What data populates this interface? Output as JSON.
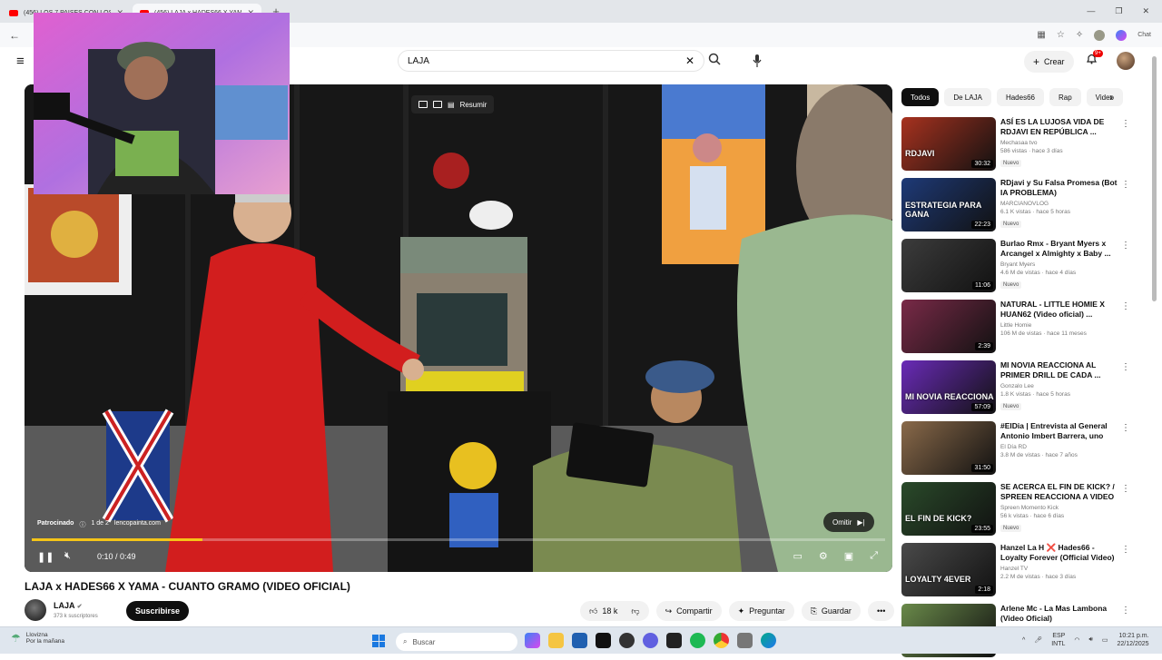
{
  "browser": {
    "tabs": [
      {
        "title": "(456) LOS 7 PAÍSES CON LOS HOM",
        "active": false
      },
      {
        "title": "(456) LAJA x HADES66 X YAMA",
        "active": true
      }
    ],
    "new_tab_icon": "plus-icon",
    "chat_label": "Chat"
  },
  "youtube": {
    "search_value": "LAJA",
    "create_label": "Crear",
    "notif_badge": "9+"
  },
  "player": {
    "overlay_summary": "Resumir",
    "sponsored": "Patrocinado",
    "ad_count": "1 de 2",
    "ad_domain": "lencopainta.com",
    "skip_label": "Omitir",
    "time": "0:10 / 0:49",
    "progress": 0.2,
    "progress_color": "#f5c518"
  },
  "video": {
    "title": "LAJA x HADES66 X YAMA - CUANTO GRAMO (VIDEO OFICIAL)",
    "channel": "LAJA",
    "subscribers": "373 k suscriptores",
    "subscribe_label": "Suscribirse",
    "likes": "18 k",
    "share_label": "Compartir",
    "ask_label": "Preguntar",
    "save_label": "Guardar"
  },
  "chips": [
    "Todos",
    "De LAJA",
    "Hades66",
    "Rap",
    "Video"
  ],
  "recommended": [
    {
      "title": "ASÍ ES LA LUJOSA VIDA DE RDJAVI EN REPÚBLICA ...",
      "channel": "Mechasaa tvo",
      "meta": "586 vistas · hace 3 días",
      "badge": "Nuevo",
      "duration": "30:32",
      "thumb": "#a8321f",
      "thumb_text": "RDJAVI"
    },
    {
      "title": "RDjavi y Su Falsa Promesa (Bot IA PROBLEMA)",
      "channel": "MARCIANOVLOG",
      "meta": "6.1 K vistas · hace 5 horas",
      "badge": "Nuevo",
      "duration": "22:23",
      "thumb": "#1e3a78",
      "thumb_text": "ESTRATEGIA PARA GANA"
    },
    {
      "title": "Burlao Rmx - Bryant Myers x Arcangel x Almighty x Baby ...",
      "channel": "Bryant Myers",
      "meta": "4.6 M de vistas · hace 4 días",
      "badge": "Nuevo",
      "duration": "11:06",
      "thumb": "#3c3c3c",
      "thumb_text": ""
    },
    {
      "title": "NATURAL - LITTLE HOMIE X HUAN62 (Video oficial) ...",
      "channel": "Little Homie",
      "meta": "106 M de vistas · hace 11 meses",
      "badge": "",
      "duration": "2:39",
      "thumb": "#7a2a48",
      "thumb_text": ""
    },
    {
      "title": "MI NOVIA REACCIONA AL PRIMER DRILL DE CADA ...",
      "channel": "Gonzalo Lee",
      "meta": "1.8 K vistas · hace 5 horas",
      "badge": "Nuevo",
      "duration": "57:09",
      "thumb": "#6a2bb8",
      "thumb_text": "MI NOVIA REACCIONA"
    },
    {
      "title": "#ElDia | Entrevista al General Antonio Imbert Barrera, uno de...",
      "channel": "El Día RD",
      "meta": "3.8 M de vistas · hace 7 años",
      "badge": "",
      "duration": "31:50",
      "thumb": "#8a6a4a",
      "thumb_text": ""
    },
    {
      "title": "SE ACERCA EL FIN DE KICK? / SPREEN REACCIONA A VIDEO ...",
      "channel": "Spreen Momento Kick",
      "meta": "56 k vistas · hace 6 días",
      "badge": "Nuevo",
      "duration": "23:55",
      "thumb": "#2a4a2a",
      "thumb_text": "EL FIN DE KICK?"
    },
    {
      "title": "Hanzel La H ❌ Hades66 - Loyalty Forever (Official Video)",
      "channel": "Hanzel TV",
      "meta": "2.2 M de vistas · hace 3 días",
      "badge": "",
      "duration": "2:18",
      "thumb": "#4a4a4a",
      "thumb_text": "LOYALTY 4EVER"
    },
    {
      "title": "Arlene Mc - La Mas Lambona (Video Oficial)",
      "channel": "",
      "meta": "",
      "badge": "",
      "duration": "",
      "thumb": "#6a8a4a",
      "thumb_text": ""
    }
  ],
  "taskbar": {
    "weather_title": "Llovizna",
    "weather_sub": "Por la mañana",
    "search_placeholder": "Buscar",
    "lang1": "ESP",
    "lang2": "INTL",
    "time": "10:21 p.m.",
    "date": "22/12/2025"
  }
}
